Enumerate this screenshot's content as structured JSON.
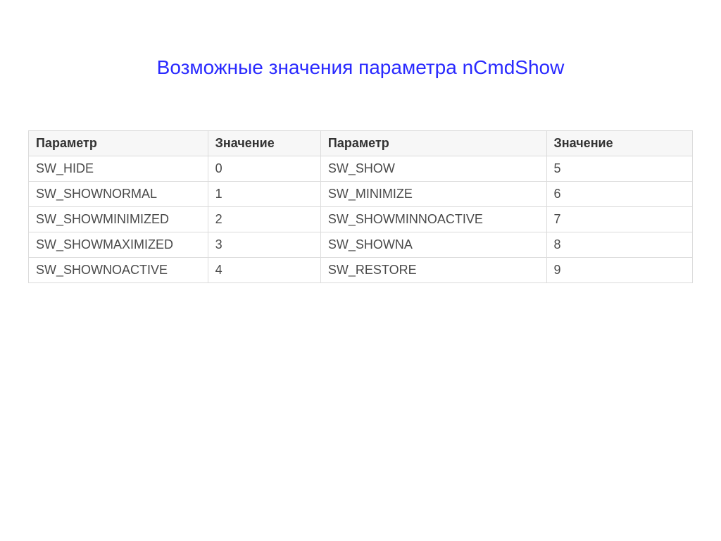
{
  "title": "Возможные значения параметра nCmdShow",
  "table": {
    "headers": [
      "Параметр",
      "Значение",
      "Параметр",
      "Значение"
    ],
    "rows": [
      [
        "SW_HIDE",
        "0",
        "SW_SHOW",
        "5"
      ],
      [
        "SW_SHOWNORMAL",
        "1",
        "SW_MINIMIZE",
        "6"
      ],
      [
        "SW_SHOWMINIMIZED",
        "2",
        "SW_SHOWMINNOACTIVE",
        "7"
      ],
      [
        "SW_SHOWMAXIMIZED",
        "3",
        "SW_SHOWNA",
        "8"
      ],
      [
        "SW_SHOWNOACTIVE",
        "4",
        "SW_RESTORE",
        "9"
      ]
    ]
  }
}
